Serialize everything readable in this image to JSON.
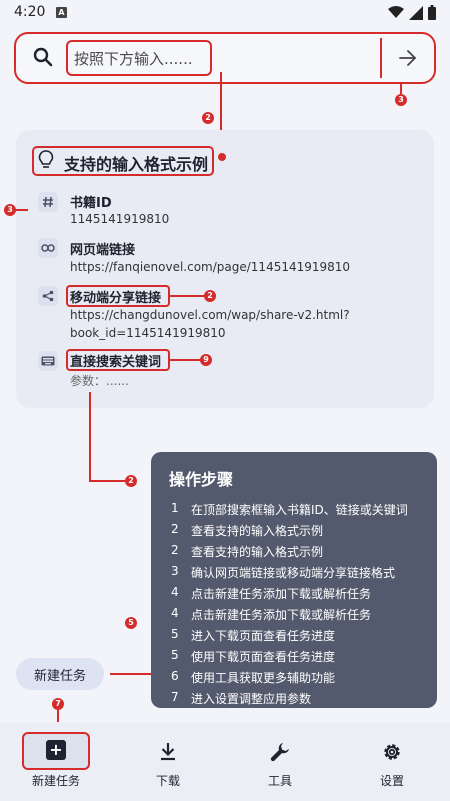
{
  "status": {
    "time": "4:20",
    "a_icon": "A"
  },
  "search": {
    "placeholder": "按照下方输入......"
  },
  "card": {
    "title": "支持的输入格式示例",
    "items": [
      {
        "label": "书籍ID",
        "value": "1145141919810",
        "icon": "hash-icon"
      },
      {
        "label": "网页端链接",
        "value": "https://fanqienovel.com/page/1145141919810",
        "icon": "link-icon"
      },
      {
        "label": "移动端分享链接",
        "value": "https://changdunovel.com/wap/share-v2.html?",
        "value2": "book_id=1145141919810",
        "icon": "share-icon"
      },
      {
        "label": "直接搜索关键词",
        "value": "参数：......",
        "icon": "keyboard-icon"
      }
    ]
  },
  "steps": {
    "title": "操作步骤",
    "rows": [
      {
        "num": "1",
        "text": "在顶部搜索框输入书籍ID、链接或关键词"
      },
      {
        "num": "2",
        "text": "查看支持的输入格式示例"
      },
      {
        "num": "2",
        "text": "查看支持的输入格式示例"
      },
      {
        "num": "3",
        "text": "确认网页端链接或移动端分享链接格式"
      },
      {
        "num": "4",
        "text": "点击新建任务添加下载或解析任务"
      },
      {
        "num": "4",
        "text": "点击新建任务添加下载或解析任务"
      },
      {
        "num": "5",
        "text": "进入下载页面查看任务进度"
      },
      {
        "num": "5",
        "text": "使用下载页面查看任务进度"
      },
      {
        "num": "6",
        "text": "使用工具获取更多辅助功能"
      },
      {
        "num": "7",
        "text": "进入设置调整应用参数"
      }
    ]
  },
  "new_task_chip": "新建任务",
  "nav": [
    {
      "label": "新建任务",
      "icon": "plus-box-icon"
    },
    {
      "label": "下载",
      "icon": "download-icon"
    },
    {
      "label": "工具",
      "icon": "wrench-icon"
    },
    {
      "label": "设置",
      "icon": "gear-icon"
    }
  ],
  "badges": {
    "a": "2",
    "b": "3",
    "c": "3",
    "d": "2",
    "e": "9",
    "f": "2",
    "g": "5",
    "h": "7"
  },
  "colors": {
    "annotation": "#d52b2b",
    "panel": "#535a6d",
    "card": "#e9ebf4",
    "background": "#f3f4f9"
  }
}
